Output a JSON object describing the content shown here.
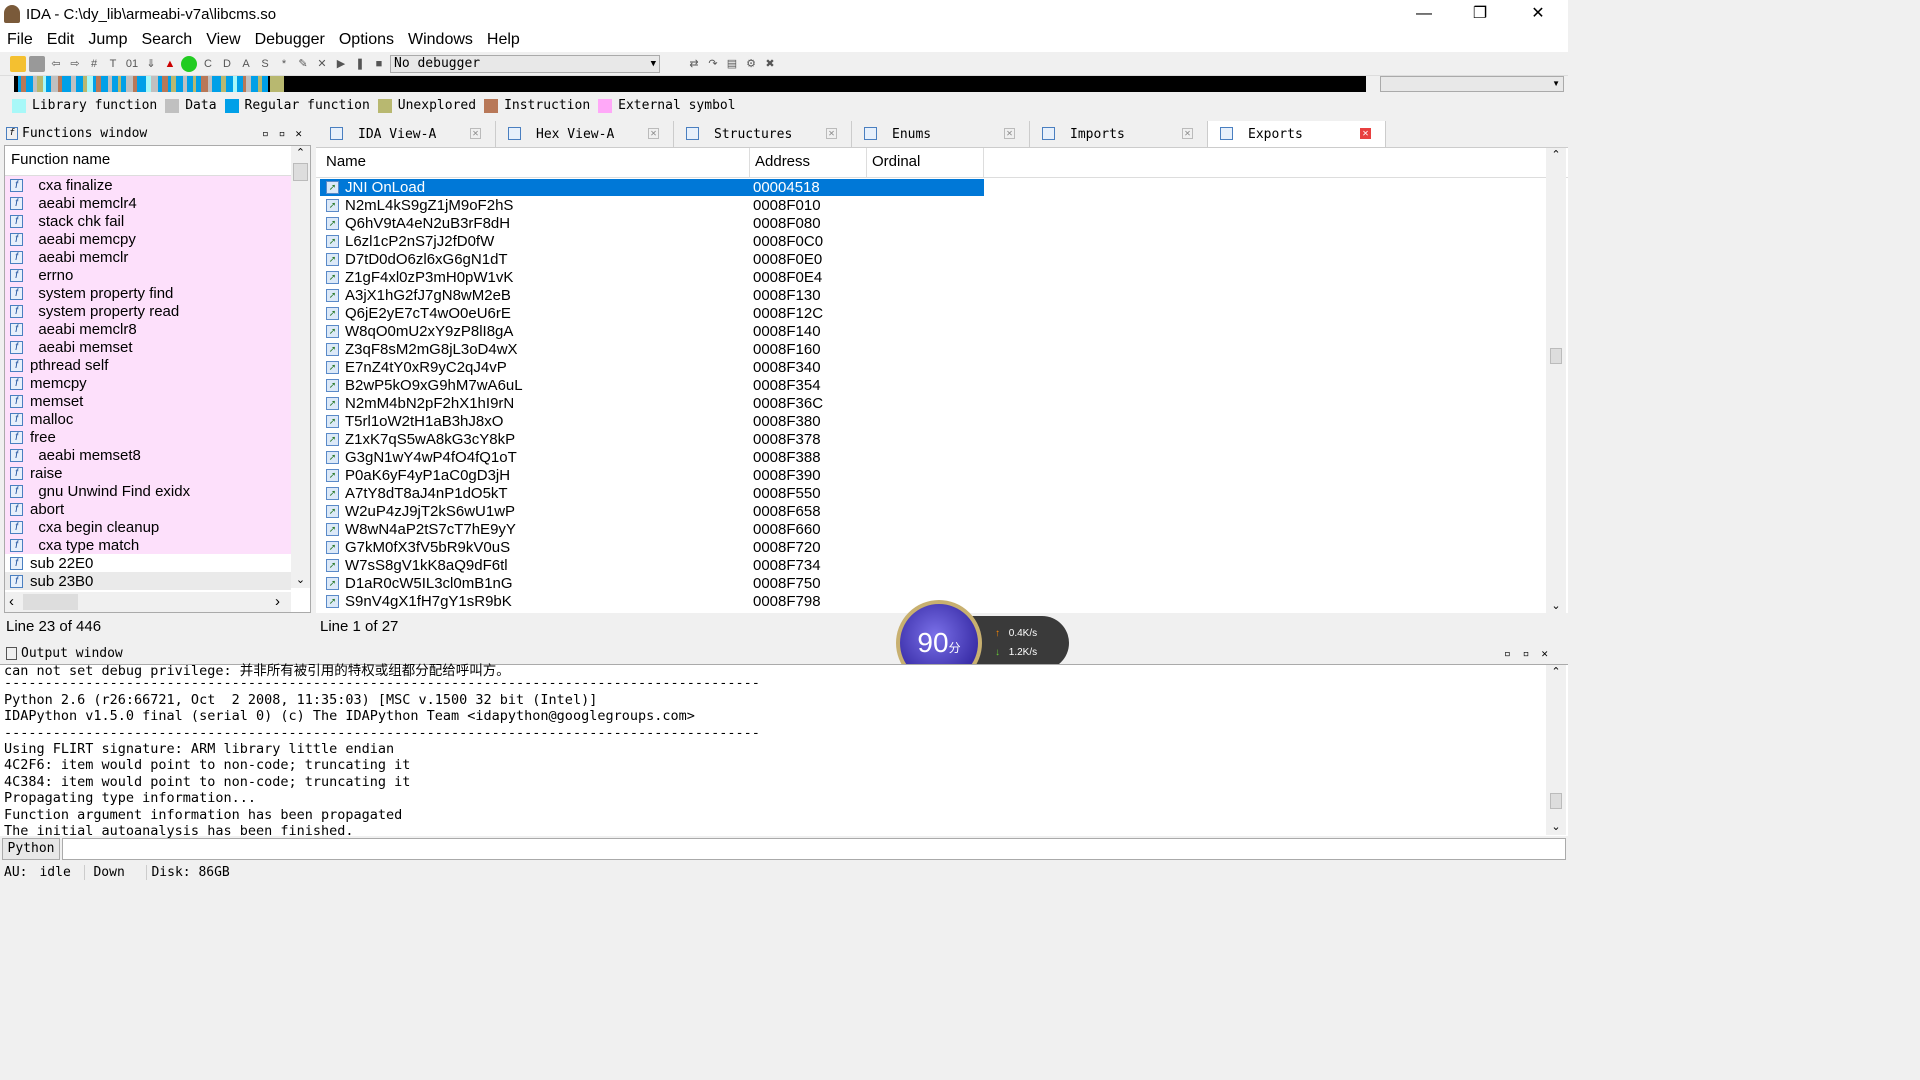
{
  "window": {
    "title": "IDA - C:\\dy_lib\\armeabi-v7a\\libcms.so"
  },
  "menu": [
    "File",
    "Edit",
    "Jump",
    "Search",
    "View",
    "Debugger",
    "Options",
    "Windows",
    "Help"
  ],
  "toolbar": {
    "debugger_select": "No debugger"
  },
  "legend": [
    {
      "label": "Library function",
      "color": "#a8f8f8"
    },
    {
      "label": "Data",
      "color": "#c0c0c0"
    },
    {
      "label": "Regular function",
      "color": "#00a0e8"
    },
    {
      "label": "Unexplored",
      "color": "#b8b870"
    },
    {
      "label": "Instruction",
      "color": "#b87858"
    },
    {
      "label": "External symbol",
      "color": "#ffa8f8"
    }
  ],
  "functions": {
    "title": "Functions window",
    "column": "Function name",
    "status": "Line 23 of 446",
    "items": [
      {
        "name": "  cxa finalize",
        "lib": true
      },
      {
        "name": "  aeabi memclr4",
        "lib": true
      },
      {
        "name": "  stack chk fail",
        "lib": true
      },
      {
        "name": "  aeabi memcpy",
        "lib": true
      },
      {
        "name": "  aeabi memclr",
        "lib": true
      },
      {
        "name": "  errno",
        "lib": true
      },
      {
        "name": "  system property find",
        "lib": true
      },
      {
        "name": "  system property read",
        "lib": true
      },
      {
        "name": "  aeabi memclr8",
        "lib": true
      },
      {
        "name": "  aeabi memset",
        "lib": true
      },
      {
        "name": "pthread self",
        "lib": true
      },
      {
        "name": "memcpy",
        "lib": true
      },
      {
        "name": "memset",
        "lib": true
      },
      {
        "name": "malloc",
        "lib": true
      },
      {
        "name": "free",
        "lib": true
      },
      {
        "name": "  aeabi memset8",
        "lib": true
      },
      {
        "name": "raise",
        "lib": true
      },
      {
        "name": "  gnu Unwind Find exidx",
        "lib": true
      },
      {
        "name": "abort",
        "lib": true
      },
      {
        "name": "  cxa begin cleanup",
        "lib": true
      },
      {
        "name": "  cxa type match",
        "lib": true
      },
      {
        "name": "sub 22E0",
        "lib": false
      },
      {
        "name": "sub 23B0",
        "lib": false,
        "current": true
      }
    ]
  },
  "tabs": [
    {
      "label": "IDA View-A"
    },
    {
      "label": "Hex View-A"
    },
    {
      "label": "Structures"
    },
    {
      "label": "Enums"
    },
    {
      "label": "Imports"
    },
    {
      "label": "Exports",
      "active": true
    }
  ],
  "exports": {
    "columns": [
      "Name",
      "Address",
      "Ordinal"
    ],
    "status": "Line 1 of 27",
    "rows": [
      [
        "JNI OnLoad",
        "00004518"
      ],
      [
        "N2mL4kS9gZ1jM9oF2hS",
        "0008F010"
      ],
      [
        "Q6hV9tA4eN2uB3rF8dH",
        "0008F080"
      ],
      [
        "L6zl1cP2nS7jJ2fD0fW",
        "0008F0C0"
      ],
      [
        "D7tD0dO6zl6xG6gN1dT",
        "0008F0E0"
      ],
      [
        "Z1gF4xl0zP3mH0pW1vK",
        "0008F0E4"
      ],
      [
        "A3jX1hG2fJ7gN8wM2eB",
        "0008F130"
      ],
      [
        "Q6jE2yE7cT4wO0eU6rE",
        "0008F12C"
      ],
      [
        "W8qO0mU2xY9zP8lI8gA",
        "0008F140"
      ],
      [
        "Z3qF8sM2mG8jL3oD4wX",
        "0008F160"
      ],
      [
        "E7nZ4tY0xR9yC2qJ4vP",
        "0008F340"
      ],
      [
        "B2wP5kO9xG9hM7wA6uL",
        "0008F354"
      ],
      [
        "N2mM4bN2pF2hX1hI9rN",
        "0008F36C"
      ],
      [
        "T5rl1oW2tH1aB3hJ8xO",
        "0008F380"
      ],
      [
        "Z1xK7qS5wA8kG3cY8kP",
        "0008F378"
      ],
      [
        "G3gN1wY4wP4fO4fQ1oT",
        "0008F388"
      ],
      [
        "P0aK6yF4yP1aC0gD3jH",
        "0008F390"
      ],
      [
        "A7tY8dT8aJ4nP1dO5kT",
        "0008F550"
      ],
      [
        "W2uP4zJ9jT2kS6wU1wP",
        "0008F658"
      ],
      [
        "W8wN4aP2tS7cT7hE9yY",
        "0008F660"
      ],
      [
        "G7kM0fX3fV5bR9kV0uS",
        "0008F720"
      ],
      [
        "W7sS8gV1kK8aQ9dF6tl",
        "0008F734"
      ],
      [
        "D1aR0cW5IL3cl0mB1nG",
        "0008F750"
      ],
      [
        "S9nV4gX1fH7gY1sR9bK",
        "0008F798"
      ]
    ]
  },
  "widget": {
    "score": "90",
    "unit": "分",
    "upload": "0.4K/s",
    "download": "1.2K/s"
  },
  "output": {
    "title": "Output window",
    "lines": [
      "can not set debug privilege: 并非所有被引用的特权或组都分配给呼叫方。",
      "---------------------------------------------------------------------------------------------",
      "Python 2.6 (r26:66721, Oct  2 2008, 11:35:03) [MSC v.1500 32 bit (Intel)]",
      "IDAPython v1.5.0 final (serial 0) (c) The IDAPython Team <idapython@googlegroups.com>",
      "---------------------------------------------------------------------------------------------",
      "Using FLIRT signature: ARM library little endian",
      "4C2F6: item would point to non-code; truncating it",
      "4C384: item would point to non-code; truncating it",
      "Propagating type information...",
      "Function argument information has been propagated",
      "The initial autoanalysis has been finished."
    ],
    "python_button": "Python"
  },
  "status": {
    "au_label": "AU:",
    "au_state": "idle",
    "direction": "Down",
    "disk": "Disk: 86GB"
  }
}
